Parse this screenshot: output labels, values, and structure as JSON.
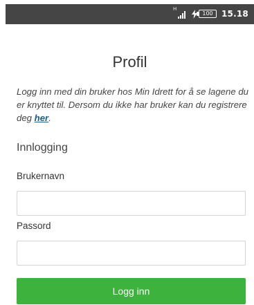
{
  "status_bar": {
    "network_indicator": "H",
    "battery_level": "100",
    "time": "15.18",
    "icons": [
      "signal-icon",
      "charging-icon",
      "battery-icon"
    ]
  },
  "page": {
    "title": "Profil",
    "intro_text": "Logg inn med din bruker hos Min Idrett for å se lagene du er knyttet til. Dersom du ikke har bruker kan du registrere deg ",
    "intro_link": "her",
    "intro_end": "."
  },
  "login": {
    "heading": "Innlogging",
    "username_label": "Brukernavn",
    "username_value": "",
    "password_label": "Passord",
    "password_value": "",
    "submit_label": "Logg inn"
  },
  "colors": {
    "status_bar_bg": "#454545",
    "button_bg": "#3db23d",
    "link": "#1a5f8a"
  }
}
